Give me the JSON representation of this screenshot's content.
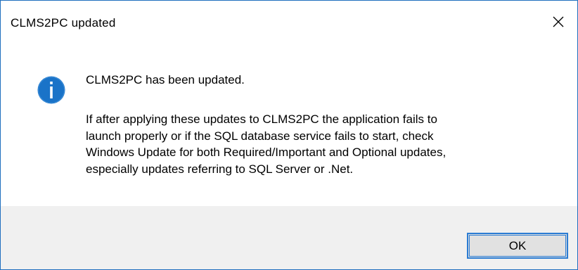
{
  "window": {
    "title": "CLMS2PC updated",
    "close_icon": "close-icon"
  },
  "content": {
    "icon": "information-icon",
    "icon_color": "#1a73c8",
    "heading": "CLMS2PC has been updated.",
    "message_lines": [
      "If after applying these updates to CLMS2PC the application fails to",
      "launch properly or if the SQL database service fails to start, check",
      "Windows Update for both Required/Important and Optional updates,",
      "especially updates referring to SQL Server or .Net."
    ]
  },
  "footer": {
    "ok_label": "OK",
    "accent_color": "#2b7cd3"
  }
}
